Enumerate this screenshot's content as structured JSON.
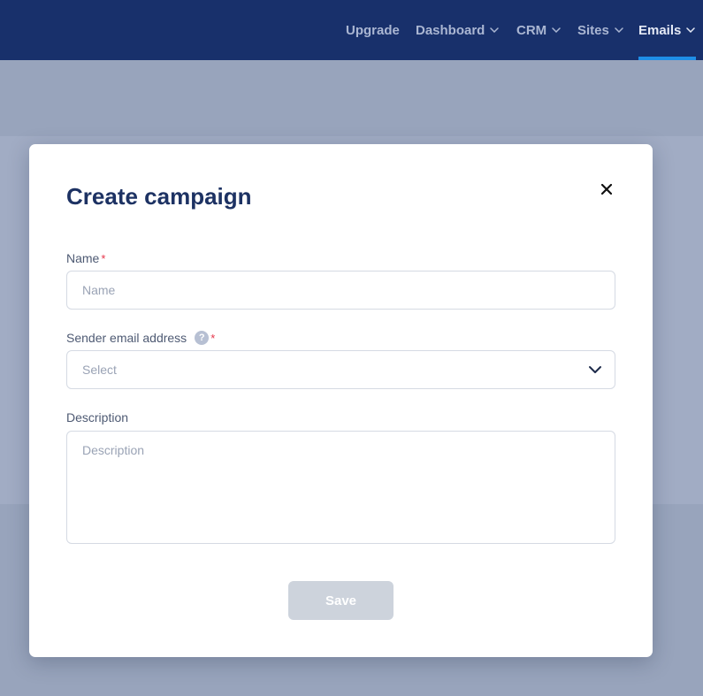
{
  "nav": {
    "items": [
      {
        "label": "Upgrade",
        "has_dropdown": false
      },
      {
        "label": "Dashboard",
        "has_dropdown": true
      },
      {
        "label": "CRM",
        "has_dropdown": true
      },
      {
        "label": "Sites",
        "has_dropdown": true
      },
      {
        "label": "Emails",
        "has_dropdown": true,
        "active": true
      }
    ],
    "background": "#18306b",
    "active_underline_color": "#1f8ee6"
  },
  "modal": {
    "title": "Create campaign",
    "close_icon": "close-icon",
    "fields": {
      "name": {
        "label": "Name",
        "required_mark": "*",
        "placeholder": "Name",
        "value": ""
      },
      "sender": {
        "label": "Sender email address",
        "help_icon": "help-icon",
        "help_glyph": "?",
        "required_mark": "*",
        "selected": "Select"
      },
      "description": {
        "label": "Description",
        "placeholder": "Description",
        "value": ""
      }
    },
    "save_label": "Save"
  }
}
